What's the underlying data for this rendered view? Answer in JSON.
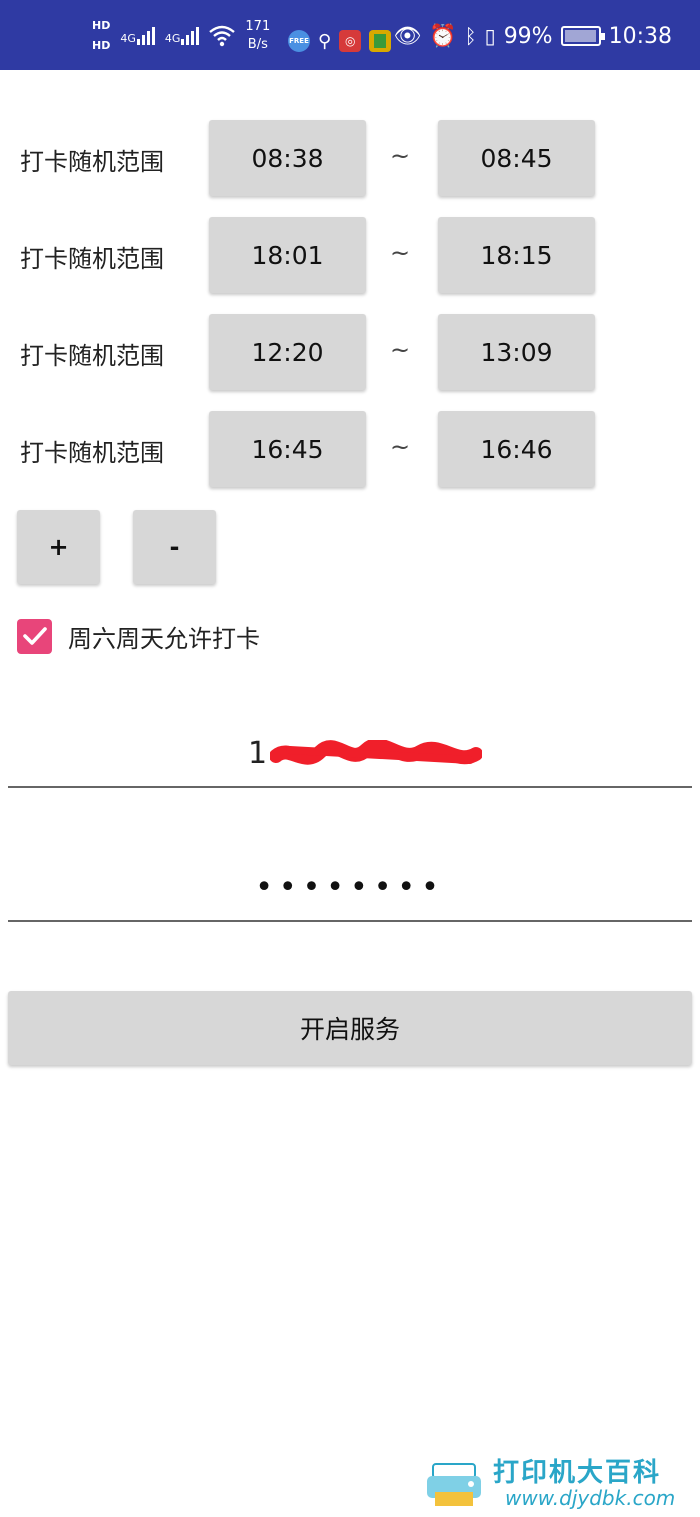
{
  "status_bar": {
    "hd1": "HD",
    "hd2": "HD",
    "net1": "4G",
    "net2": "4G",
    "speed_value": "171",
    "speed_unit": "B/s",
    "free_badge": "FREE",
    "battery_pct": "99%",
    "battery_level": 0.99,
    "time": "10:38"
  },
  "ranges": [
    {
      "label": "打卡随机范围",
      "start": "08:38",
      "end": "08:45",
      "sep": "~"
    },
    {
      "label": "打卡随机范围",
      "start": "18:01",
      "end": "18:15",
      "sep": "~"
    },
    {
      "label": "打卡随机范围",
      "start": "12:20",
      "end": "13:09",
      "sep": "~"
    },
    {
      "label": "打卡随机范围",
      "start": "16:45",
      "end": "16:46",
      "sep": "~"
    }
  ],
  "controls": {
    "add_label": "+",
    "remove_label": "-"
  },
  "weekend": {
    "label": "周六周天允许打卡",
    "checked": true,
    "accent": "#e8457a"
  },
  "phone": {
    "visible_prefix": "1"
  },
  "password": {
    "masked": "••••••••"
  },
  "start_service": {
    "label": "开启服务"
  },
  "watermark": {
    "title": "打印机大百科",
    "url": "www.djydbk.com"
  },
  "colors": {
    "status_bar": "#2f3aa3",
    "button_bg": "#d7d7d7",
    "checkbox": "#e8457a",
    "watermark": "#2aa6c8"
  }
}
